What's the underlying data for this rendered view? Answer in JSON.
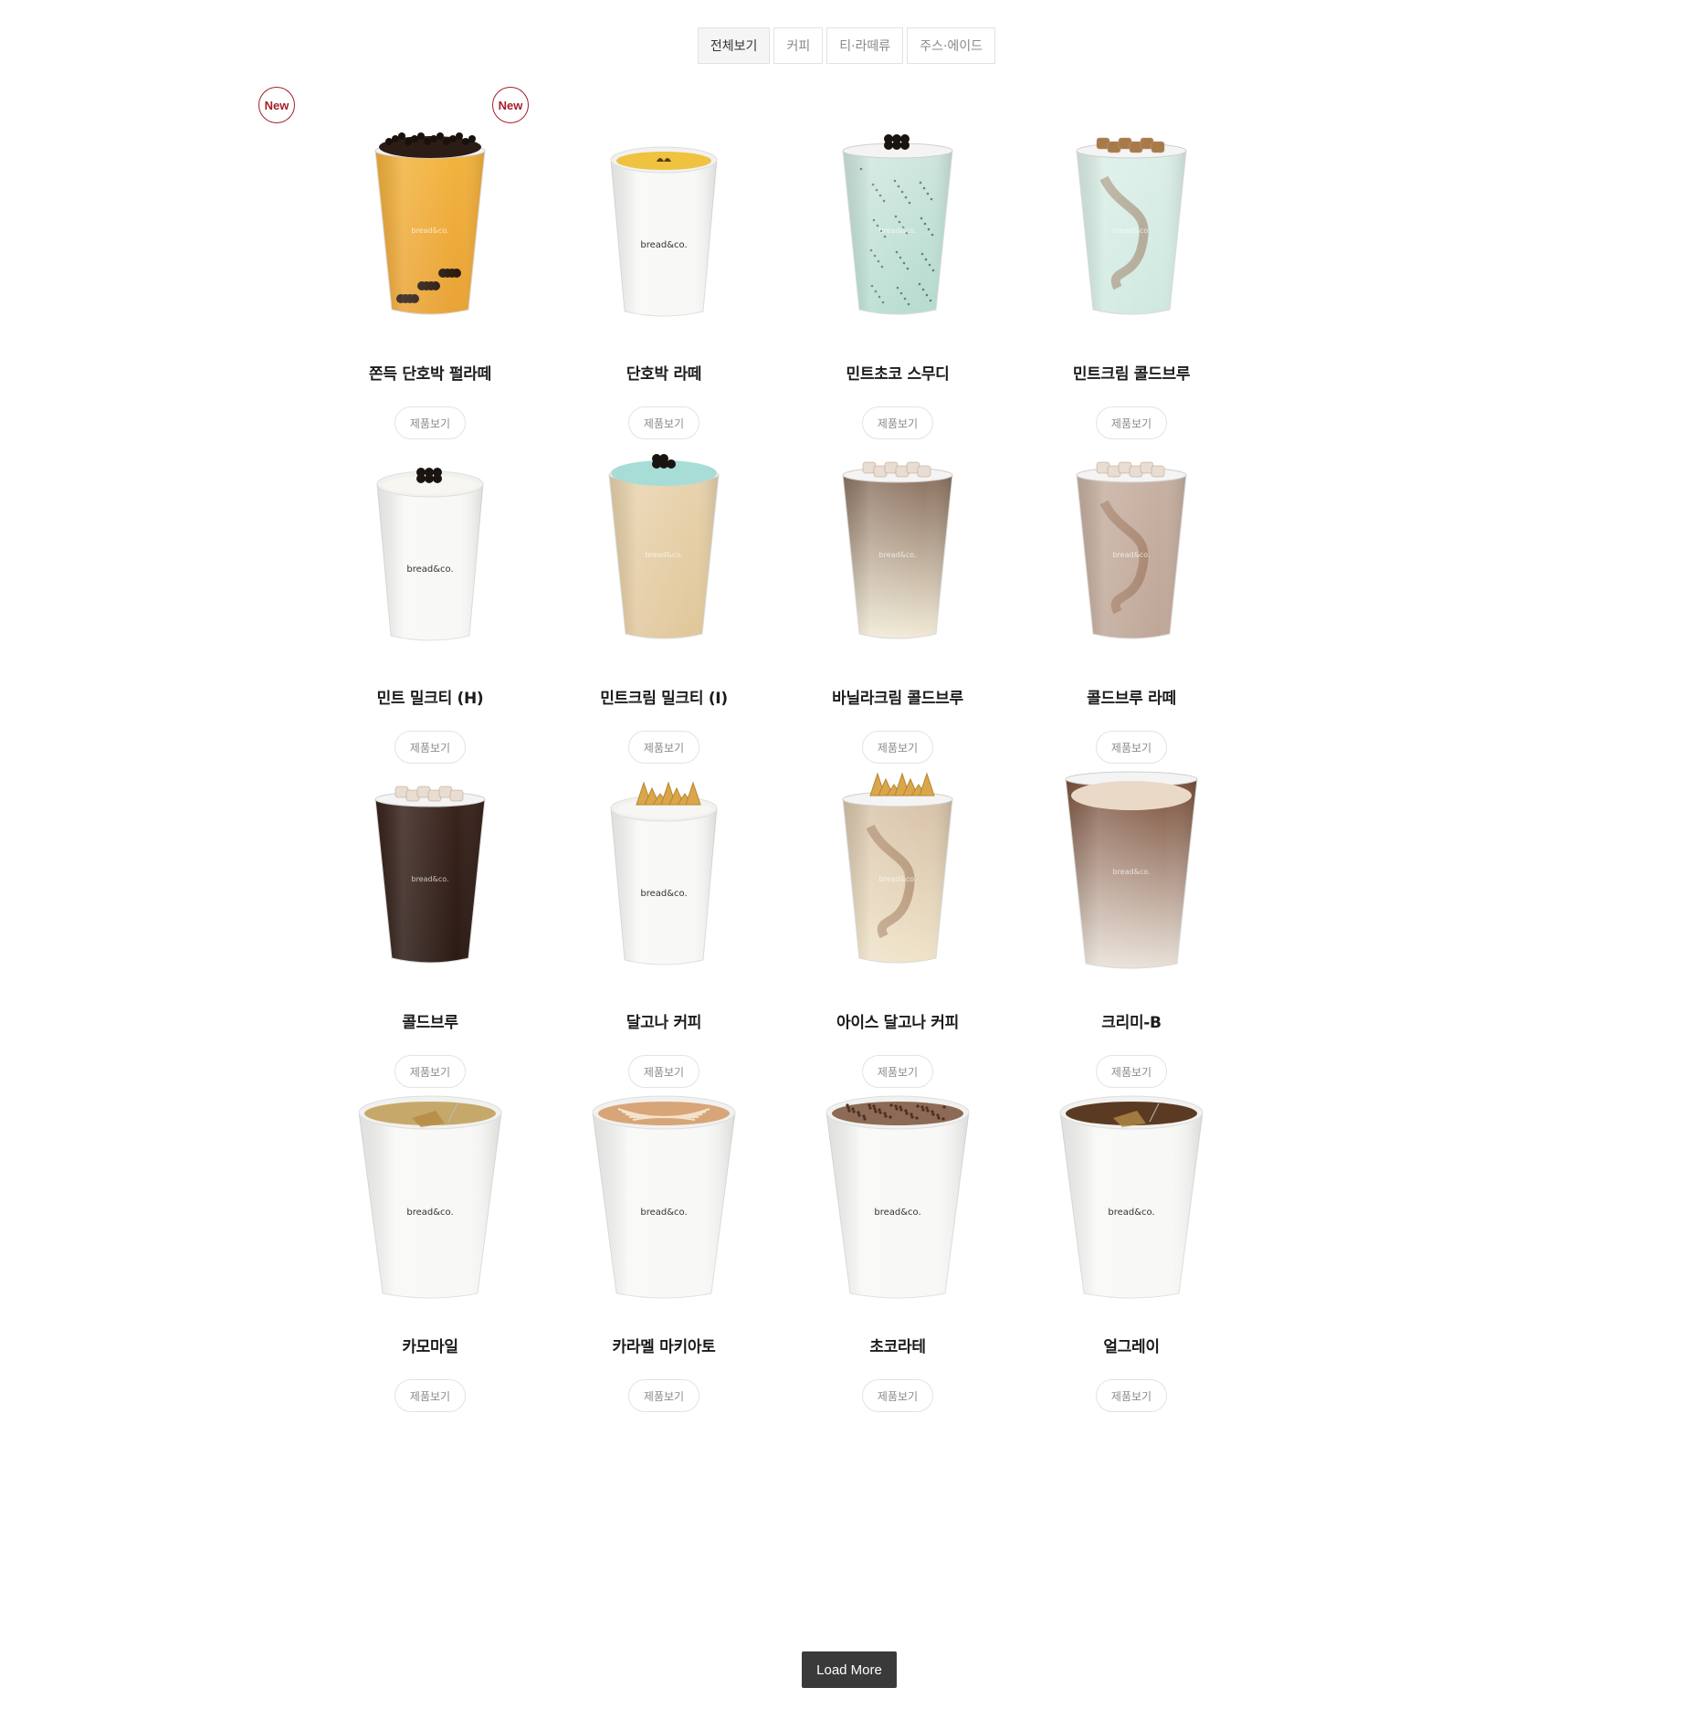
{
  "tabs": [
    {
      "label": "전체보기",
      "active": true
    },
    {
      "label": "커피",
      "active": false
    },
    {
      "label": "티·라떼류",
      "active": false
    },
    {
      "label": "주스·에이드",
      "active": false
    }
  ],
  "new_badge_label": "New",
  "view_button_label": "제품보기",
  "cup_brand": "bread&co.",
  "load_more_label": "Load More",
  "products": [
    {
      "name": "쫀득 단호박 펄라떼",
      "is_new": true,
      "style": "iced",
      "drink": "#f3b33d",
      "bottom": "#e9a235",
      "topping": "cookie",
      "pearls": true
    },
    {
      "name": "단호박 라떼",
      "is_new": true,
      "style": "hot-lid",
      "drink": "#efc240",
      "topping": "latte-leaf"
    },
    {
      "name": "민트초코 스무디",
      "is_new": false,
      "style": "iced",
      "drink": "#cfe7df",
      "bottom": "#b6dccf",
      "topping": "pearls-top",
      "speckle": true
    },
    {
      "name": "민트크림 콜드브루",
      "is_new": false,
      "style": "iced",
      "drink": "#dcefe8",
      "bottom": "#cfe9e0",
      "topping": "caramel",
      "swirl": true
    },
    {
      "name": "민트 밀크티 (H)",
      "is_new": false,
      "style": "hot-lid",
      "drink": "#f7f6f0",
      "topping": "pearls-top"
    },
    {
      "name": "민트크림 밀크티 (I)",
      "is_new": false,
      "style": "iced",
      "drink": "#e8d3ad",
      "bottom": "#e1c79b",
      "topping": "mint-foam"
    },
    {
      "name": "바닐라크림 콜드브루",
      "is_new": false,
      "style": "iced",
      "drink": "#8b715f",
      "bottom": "#f1ead6",
      "topping": "ice"
    },
    {
      "name": "콜드브루 라떼",
      "is_new": false,
      "style": "iced",
      "drink": "#c7b0a1",
      "bottom": "#bfa798",
      "topping": "ice",
      "swirl": true
    },
    {
      "name": "콜드브루",
      "is_new": false,
      "style": "iced",
      "drink": "#3a231c",
      "bottom": "#2b1a14",
      "topping": "ice"
    },
    {
      "name": "달고나 커피",
      "is_new": false,
      "style": "hot-lid",
      "drink": "#f7f6f2",
      "topping": "dalgona"
    },
    {
      "name": "아이스 달고나 커피",
      "is_new": false,
      "style": "iced",
      "drink": "#d8c3a9",
      "bottom": "#efe3c8",
      "topping": "dalgona",
      "swirl": true
    },
    {
      "name": "크리미-B",
      "is_new": false,
      "style": "iced-tall",
      "drink": "#7a4f3a",
      "bottom": "#e9e1d8",
      "topping": "cream"
    },
    {
      "name": "카모마일",
      "is_new": false,
      "style": "hot-open",
      "drink": "#c6a96a",
      "topping": "teabag"
    },
    {
      "name": "카라멜 마키아토",
      "is_new": false,
      "style": "hot-open",
      "drink": "#d7a577",
      "topping": "caramel-art"
    },
    {
      "name": "초코라테",
      "is_new": false,
      "style": "hot-open",
      "drink": "#8c6a55",
      "topping": "cocoa"
    },
    {
      "name": "얼그레이",
      "is_new": false,
      "style": "hot-open",
      "drink": "#5b3a23",
      "topping": "teabag"
    }
  ]
}
